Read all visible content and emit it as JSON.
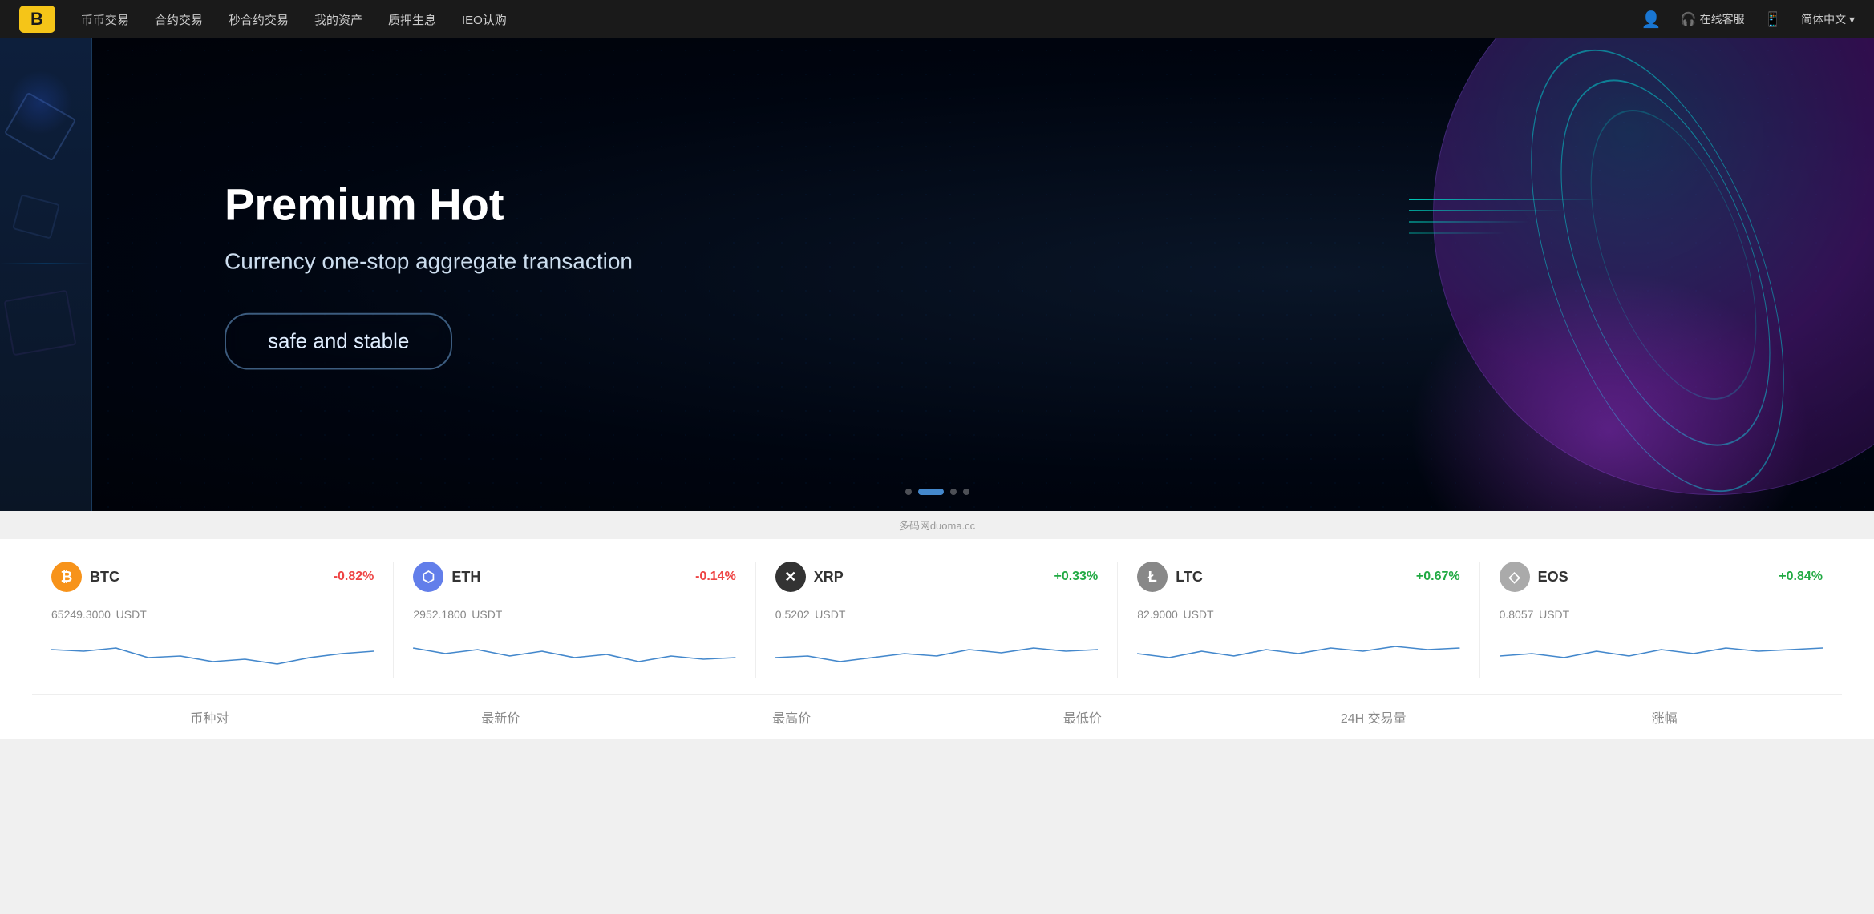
{
  "navbar": {
    "logo": "B",
    "menu": [
      {
        "label": "币币交易",
        "href": "#"
      },
      {
        "label": "合约交易",
        "href": "#"
      },
      {
        "label": "秒合约交易",
        "href": "#"
      },
      {
        "label": "我的资产",
        "href": "#"
      },
      {
        "label": "质押生息",
        "href": "#"
      },
      {
        "label": "IEO认购",
        "href": "#"
      }
    ],
    "online_service": "在线客服",
    "download_icon": "📱",
    "language": "简体中文"
  },
  "hero": {
    "title": "Premium Hot",
    "subtitle": "Currency one-stop aggregate transaction",
    "cta_label": "safe and stable",
    "slide_dots": [
      false,
      true,
      false,
      false
    ]
  },
  "watermark": {
    "text": "多码网duoma.cc"
  },
  "tickers": [
    {
      "symbol": "BTC",
      "icon_type": "btc",
      "icon_label": "₿",
      "change": "-0.82%",
      "change_positive": false,
      "price": "65249.3000",
      "unit": "USDT",
      "sparkline_color": "#4488cc"
    },
    {
      "symbol": "ETH",
      "icon_type": "eth",
      "icon_label": "⬡",
      "change": "-0.14%",
      "change_positive": false,
      "price": "2952.1800",
      "unit": "USDT",
      "sparkline_color": "#4488cc"
    },
    {
      "symbol": "XRP",
      "icon_type": "xrp",
      "icon_label": "✕",
      "change": "+0.33%",
      "change_positive": true,
      "price": "0.5202",
      "unit": "USDT",
      "sparkline_color": "#4488cc"
    },
    {
      "symbol": "LTC",
      "icon_type": "ltc",
      "icon_label": "Ł",
      "change": "+0.67%",
      "change_positive": true,
      "price": "82.9000",
      "unit": "USDT",
      "sparkline_color": "#4488cc"
    },
    {
      "symbol": "EOS",
      "icon_type": "eos",
      "icon_label": "◇",
      "change": "+0.84%",
      "change_positive": true,
      "price": "0.8057",
      "unit": "USDT",
      "sparkline_color": "#4488cc"
    }
  ],
  "table_headers": [
    {
      "label": "币种对"
    },
    {
      "label": "最新价"
    },
    {
      "label": "最高价"
    },
    {
      "label": "最低价"
    },
    {
      "label": "24H 交易量"
    },
    {
      "label": "涨幅"
    }
  ]
}
